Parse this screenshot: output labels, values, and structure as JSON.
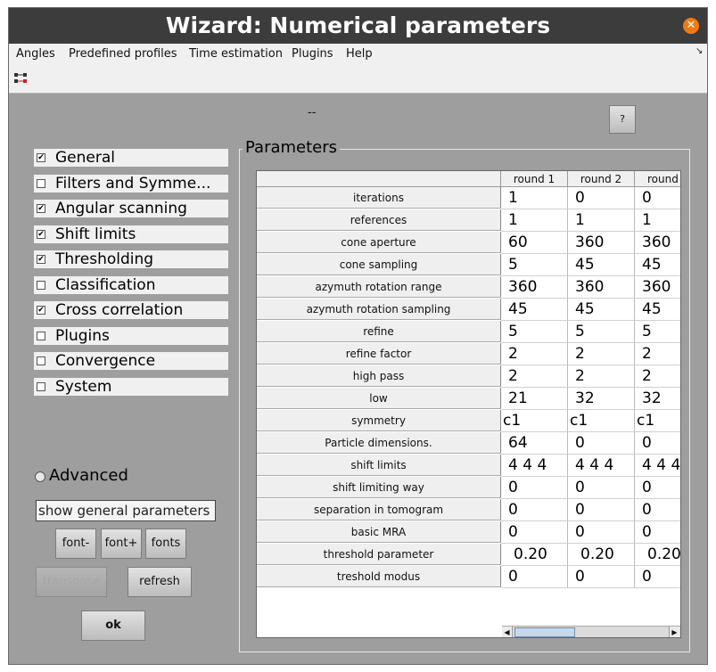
{
  "window": {
    "title": "Wizard: Numerical parameters",
    "close_icon": "close-icon"
  },
  "menubar": {
    "items": [
      "Angles",
      "Predefined profiles",
      "Time estimation",
      "Plugins",
      "Help"
    ]
  },
  "status_text": "--",
  "help_button": "?",
  "sections": [
    {
      "label": "General",
      "checked": true
    },
    {
      "label": "Filters and Symme...",
      "checked": false
    },
    {
      "label": "Angular scanning",
      "checked": true
    },
    {
      "label": "Shift limits",
      "checked": true
    },
    {
      "label": "Thresholding",
      "checked": true
    },
    {
      "label": "Classification",
      "checked": false
    },
    {
      "label": "Cross correlation",
      "checked": true
    },
    {
      "label": "Plugins",
      "checked": false
    },
    {
      "label": "Convergence",
      "checked": false
    },
    {
      "label": "System",
      "checked": false
    }
  ],
  "advanced": {
    "label": "Advanced",
    "selected": false
  },
  "show_field": "show general parameters",
  "buttons": {
    "font_minus": "font-",
    "font_plus": "font+",
    "fonts": "fonts",
    "transpose": "transpose",
    "refresh": "refresh",
    "ok": "ok"
  },
  "parameters": {
    "title": "Parameters",
    "columns": [
      "round 1",
      "round 2",
      "round"
    ],
    "rows": [
      {
        "label": "iterations",
        "values": [
          "1",
          "0",
          "0"
        ]
      },
      {
        "label": "references",
        "values": [
          "1",
          "1",
          "1"
        ]
      },
      {
        "label": "cone aperture",
        "values": [
          "60",
          "360",
          "360"
        ]
      },
      {
        "label": "cone sampling",
        "values": [
          "5",
          "45",
          "45"
        ]
      },
      {
        "label": "azymuth rotation range",
        "values": [
          "360",
          "360",
          "360"
        ]
      },
      {
        "label": "azymuth rotation sampling",
        "values": [
          "45",
          "45",
          "45"
        ]
      },
      {
        "label": "refine",
        "values": [
          "5",
          "5",
          "5"
        ]
      },
      {
        "label": "refine factor",
        "values": [
          "2",
          "2",
          "2"
        ]
      },
      {
        "label": "high pass",
        "values": [
          "2",
          "2",
          "2"
        ]
      },
      {
        "label": "low",
        "values": [
          "21",
          "32",
          "32"
        ]
      },
      {
        "label": "symmetry",
        "values": [
          "c1",
          "c1",
          "c1"
        ]
      },
      {
        "label": "Particle dimensions.",
        "values": [
          "64",
          "0",
          "0"
        ]
      },
      {
        "label": "shift limits",
        "values": [
          "4 4 4",
          "4 4 4",
          "4 4 4"
        ]
      },
      {
        "label": "shift limiting way",
        "values": [
          "0",
          "0",
          "0"
        ]
      },
      {
        "label": "separation in tomogram",
        "values": [
          "0",
          "0",
          "0"
        ]
      },
      {
        "label": "basic MRA",
        "values": [
          "0",
          "0",
          "0"
        ]
      },
      {
        "label": "threshold parameter",
        "values": [
          "0.20",
          "0.20",
          "0.20"
        ]
      },
      {
        "label": "treshold modus",
        "values": [
          "0",
          "0",
          "0"
        ]
      }
    ]
  }
}
